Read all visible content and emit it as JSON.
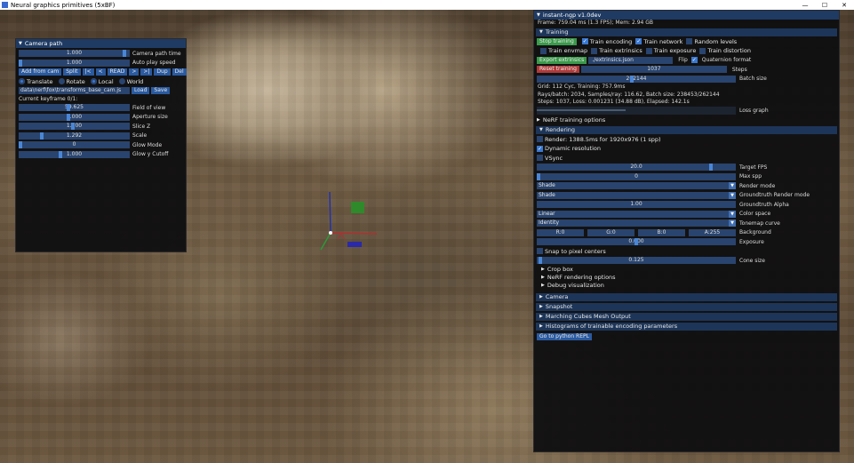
{
  "os": {
    "title": "Neural graphics primitives (5xBF)",
    "minimize": "—",
    "maximize": "☐",
    "close": "✕"
  },
  "camera": {
    "title": "Camera path",
    "rows": [
      {
        "value": "1.000",
        "label": "Camera path time",
        "frac": 0.97
      },
      {
        "value": "1.000",
        "label": "Auto play speed",
        "frac": 0.0
      }
    ],
    "buttons": [
      "Add from cam",
      "Split",
      "|<",
      "<",
      "READ",
      ">",
      ">|",
      "Dup",
      "Del"
    ],
    "modes": [
      {
        "label": "Translate",
        "on": true
      },
      {
        "label": "Rotate",
        "on": false
      },
      {
        "label": "Local",
        "on": true
      },
      {
        "label": "World",
        "on": false
      }
    ],
    "path_value": "data\\nerf\\fox\\transforms_base_cam.js",
    "load": "Load",
    "save": "Save",
    "keyframe": "Current keyframe 0/1:",
    "params": [
      {
        "value": "59.625",
        "label": "Field of view",
        "frac": 0.45
      },
      {
        "value": "1.000",
        "label": "Aperture size",
        "frac": 0.45
      },
      {
        "value": "1.000",
        "label": "Slice Z",
        "frac": 0.49
      },
      {
        "value": "1.292",
        "label": "Scale",
        "frac": 0.2
      },
      {
        "value": "0",
        "label": "Glow Mode",
        "frac": 0.0
      },
      {
        "value": "1.000",
        "label": "Glow y Cutoff",
        "frac": 0.37
      }
    ]
  },
  "ngp": {
    "title": "instant-ngp v1.0dev",
    "stats": "Frame: 759.04 ms (1.3 FPS); Mem: 2.94 GB",
    "training": {
      "title": "Training",
      "stop": "Stop training",
      "checks1": [
        {
          "label": "Train encoding",
          "on": true
        },
        {
          "label": "Train network",
          "on": true
        },
        {
          "label": "Random levels",
          "on": false
        }
      ],
      "checks2": [
        {
          "label": "Train envmap",
          "on": false
        },
        {
          "label": "Train extrinsics",
          "on": false
        },
        {
          "label": "Train exposure",
          "on": false
        },
        {
          "label": "Train distortion",
          "on": false
        }
      ],
      "export_btn": "Export extrinsics",
      "export_path": "./extrinsics.json",
      "flip": "Flip",
      "quat": "Quaternion format",
      "reset": "Reset training",
      "reset_value": "1037",
      "reset_label": "Steps",
      "batch_value": "262144",
      "batch_label": "Batch size",
      "info1": "Grid: 112 Cyc, Training: 757.9ms",
      "info2": "Rays/batch: 2034, Samples/ray: 116.62, Batch size: 238453/262144",
      "info3": "Steps: 1037, Loss: 0.001231 (34.88 dB), Elapsed: 142.1s",
      "loss_label": "Loss graph",
      "nerf_opts": "NeRF training options"
    },
    "rendering": {
      "title": "Rendering",
      "render_info": "Render: 1388.5ms for 1920x976 (1 spp)",
      "dyn_res": "Dynamic resolution",
      "vsync": "VSync",
      "target_fps": "20.0",
      "target_fps_label": "Target FPS",
      "target_frac": 0.88,
      "max_spp": "0",
      "max_spp_label": "Max spp",
      "render_mode": "Shade",
      "render_mode_label": "Render mode",
      "gt_mode": "Shade",
      "gt_mode_label": "Groundtruth Render mode",
      "gt_alpha": "1.00",
      "gt_alpha_label": "Groundtruth Alpha",
      "color_space": "Linear",
      "color_space_label": "Color space",
      "tonemap": "Identity",
      "tonemap_label": "Tonemap curve",
      "bg": [
        "R:0",
        "G:0",
        "B:0",
        "A:255"
      ],
      "bg_label": "Background",
      "exposure": "0.000",
      "exposure_label": "Exposure",
      "snap": "Snap to pixel centers",
      "cone": "0.125",
      "cone_label": "Cone size",
      "sub": [
        "Crop box",
        "NeRF rendering options",
        "Debug visualization"
      ]
    },
    "sections": [
      "Camera",
      "Snapshot",
      "Marching Cubes Mesh Output",
      "Histograms of trainable encoding parameters"
    ],
    "python_btn": "Go to python REPL"
  }
}
